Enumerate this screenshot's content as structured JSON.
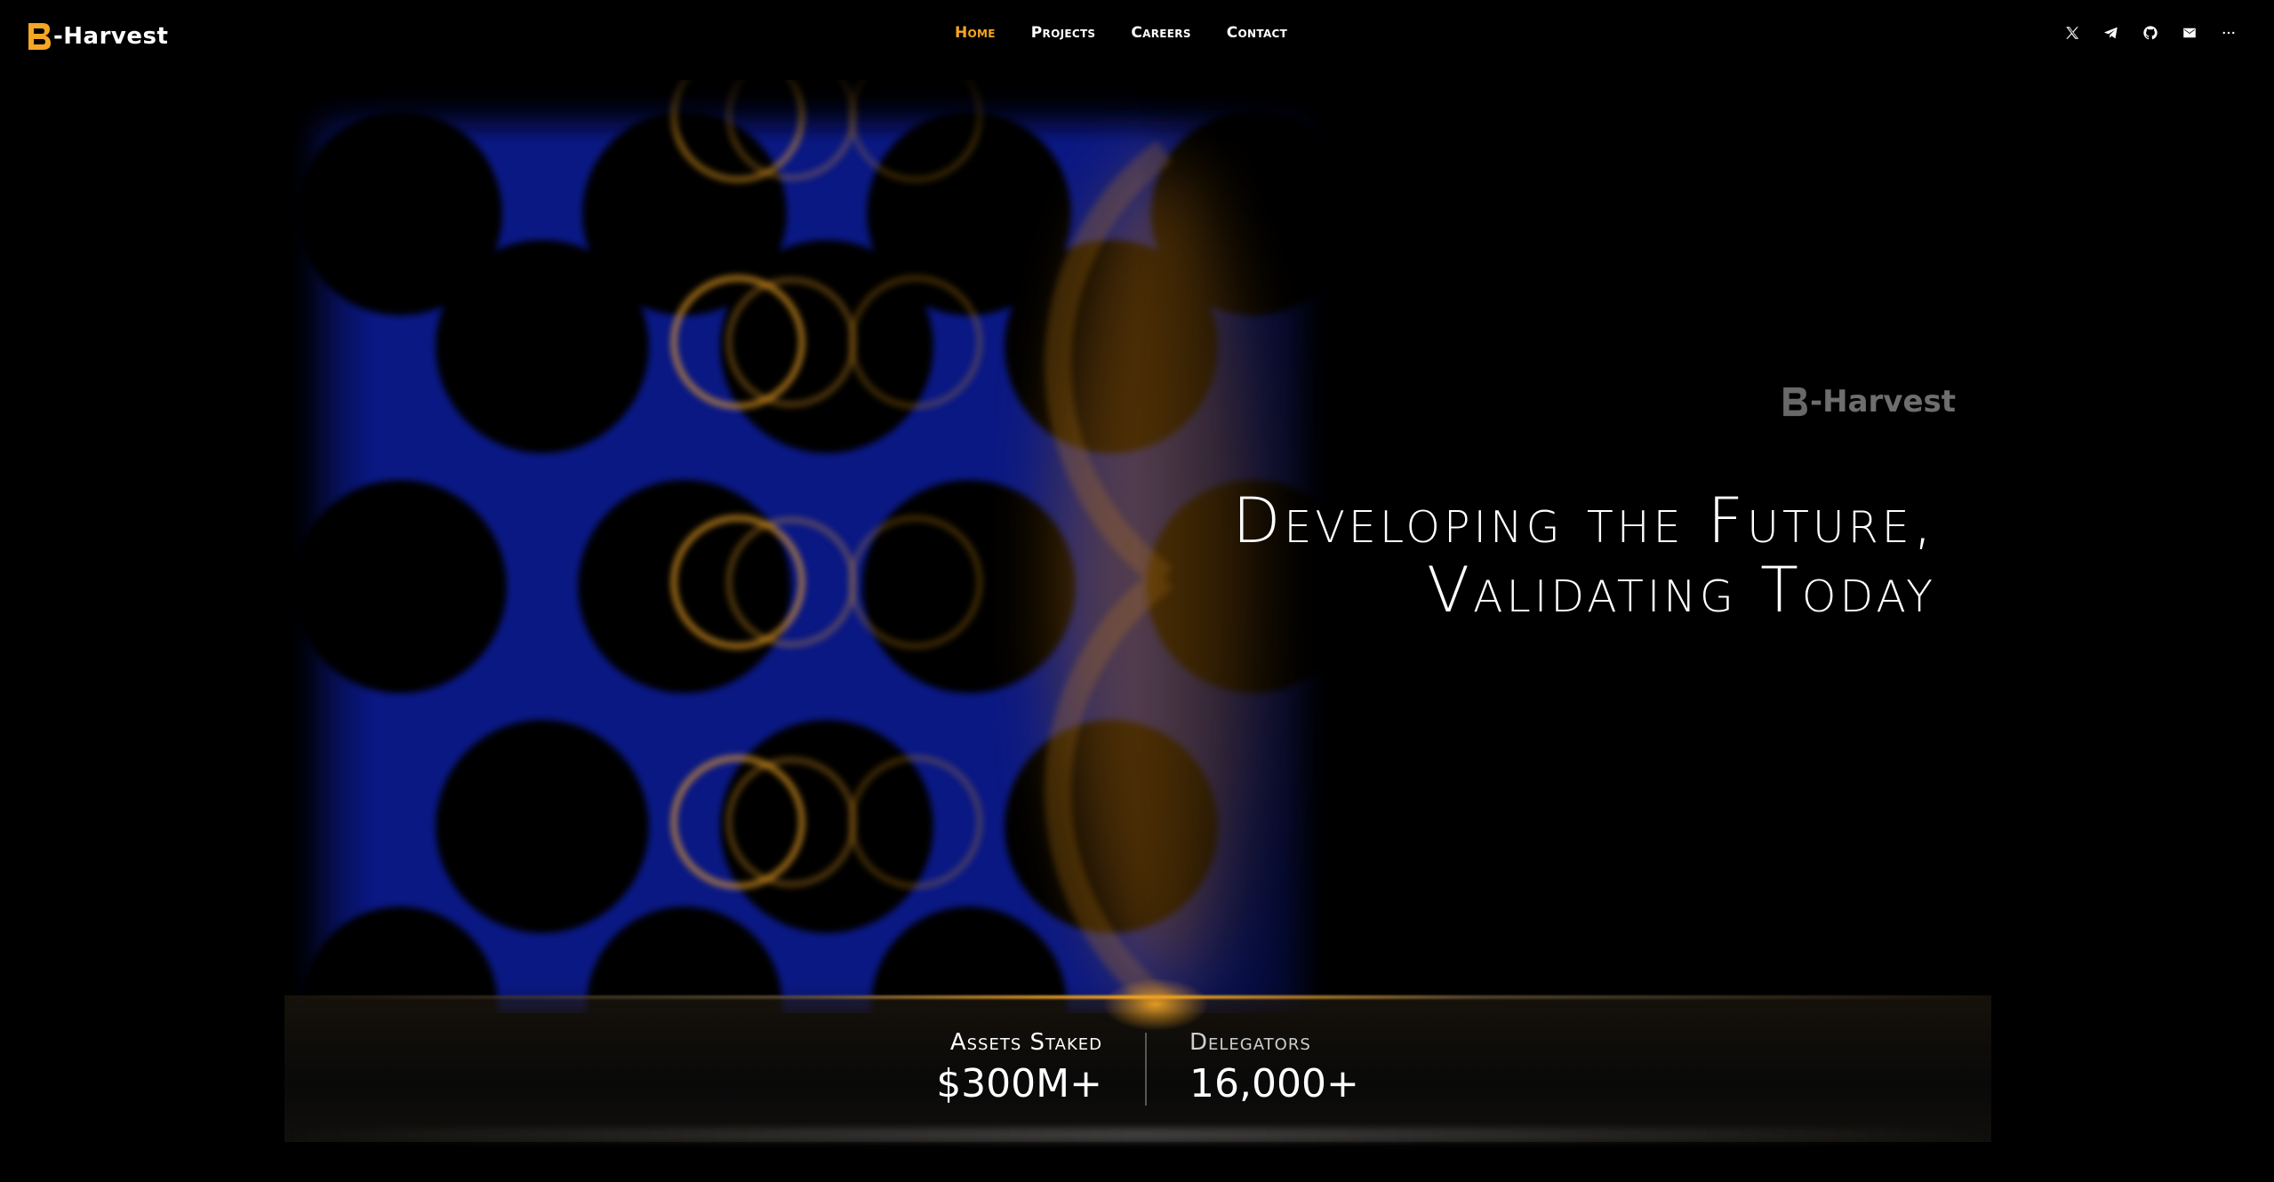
{
  "brand": {
    "name": "-Harvest",
    "accent": "#f5a623",
    "mark_icon": "b-harvest-logo-icon"
  },
  "nav": {
    "items": [
      {
        "label": "Home",
        "active": true
      },
      {
        "label": "Projects",
        "active": false
      },
      {
        "label": "Careers",
        "active": false
      },
      {
        "label": "Contact",
        "active": false
      }
    ]
  },
  "social": {
    "icons": [
      "x-icon",
      "telegram-icon",
      "github-icon",
      "mail-icon",
      "more-icon"
    ]
  },
  "hero": {
    "logo_text": "-Harvest",
    "headline_line1": "Developing the Future,",
    "headline_line2": "Validating Today"
  },
  "stats": {
    "assets_label": "Assets Staked",
    "assets_value": "$300M+",
    "delegators_label": "Delegators",
    "delegators_value": "16,000+"
  },
  "colors": {
    "background": "#000000",
    "accent": "#f5a623",
    "art_blue": "#1a3cff",
    "text": "#ffffff"
  }
}
